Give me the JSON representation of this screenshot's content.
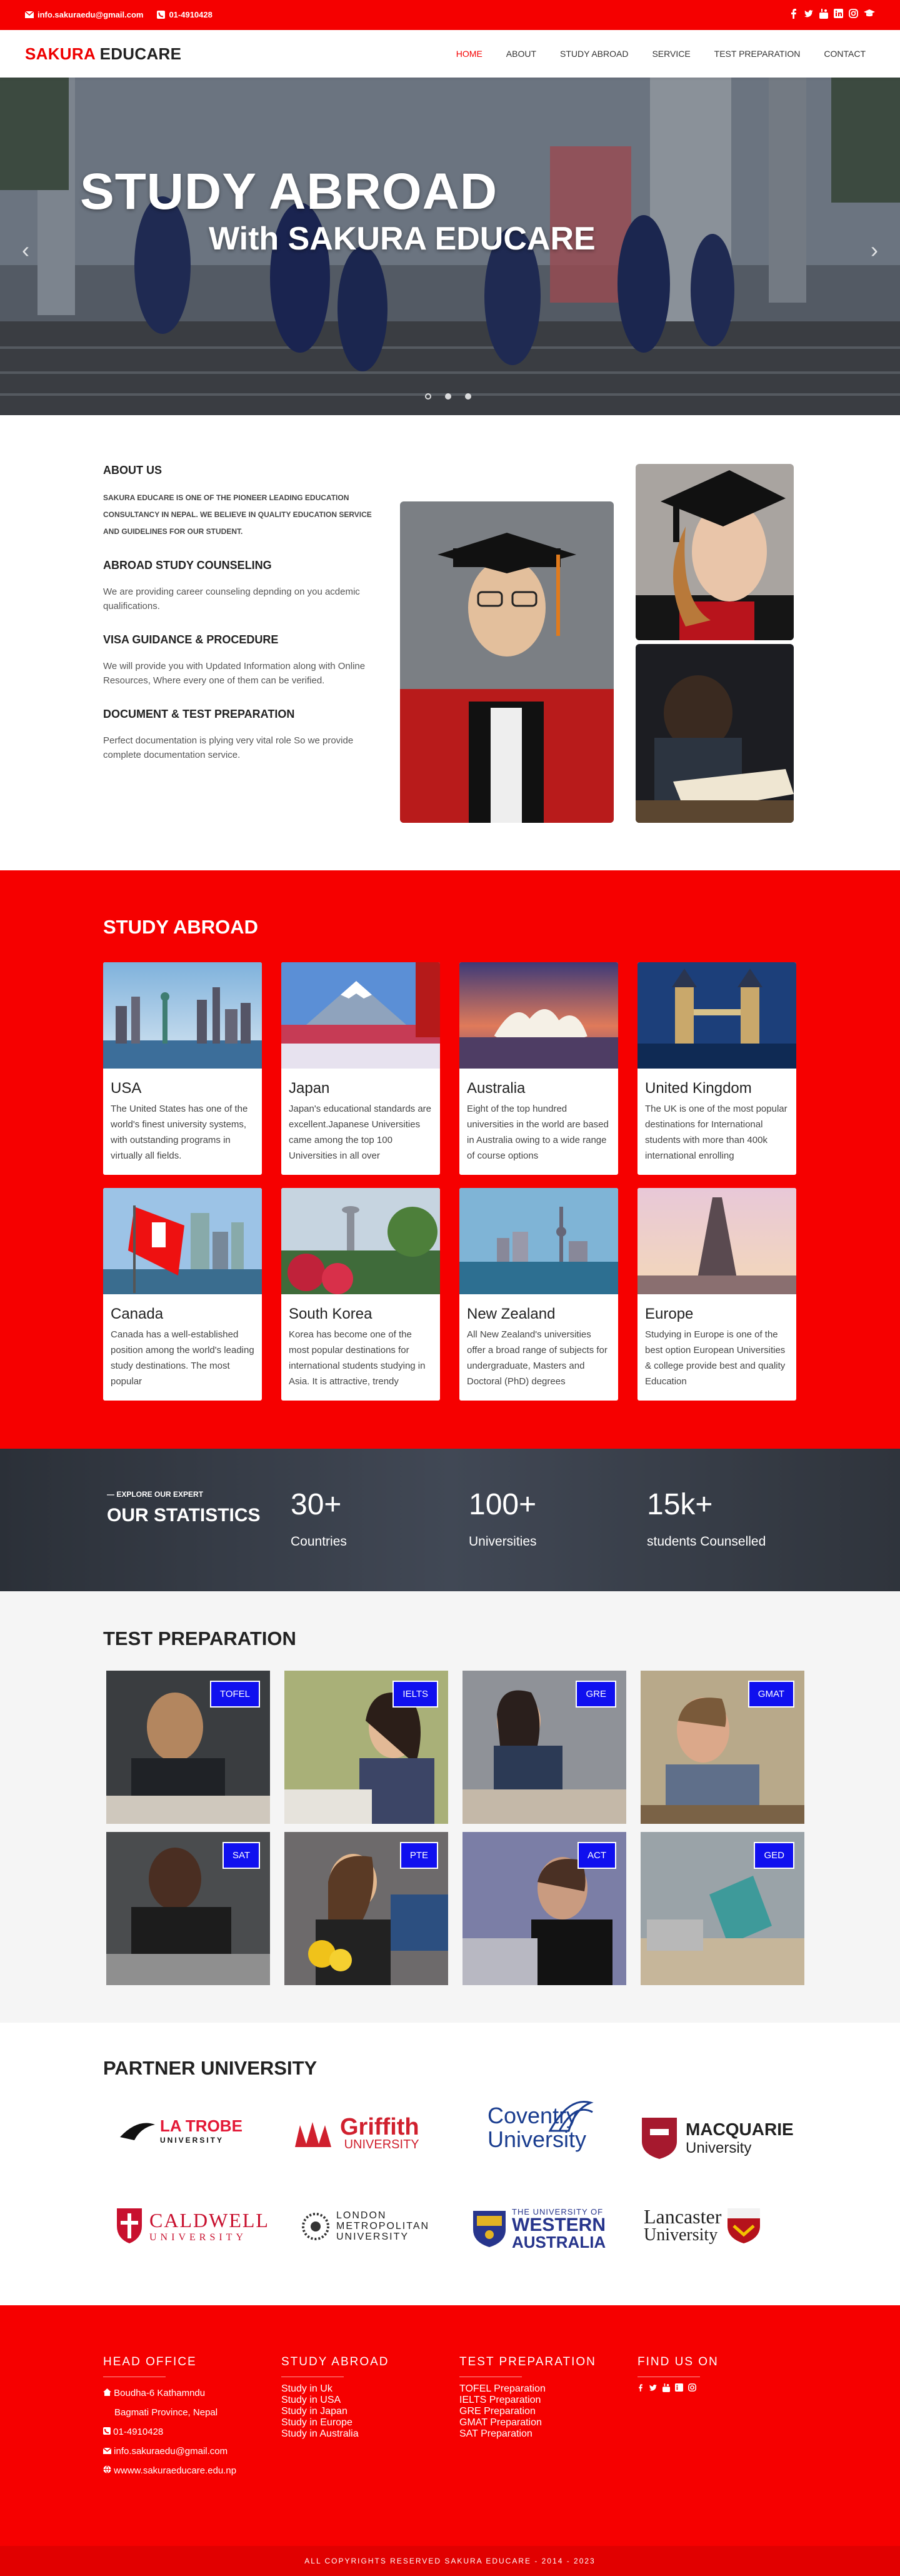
{
  "topbar": {
    "email": "info.sakuraedu@gmail.com",
    "phone": "01-4910428",
    "social_icons": [
      "facebook-icon",
      "twitter-icon",
      "youtube-icon",
      "linkedin-icon",
      "instagram-icon",
      "graduation-cap-icon"
    ]
  },
  "nav": {
    "logo_red": "SAKURA",
    "logo_dark": "EDUCARE",
    "items": [
      "HOME",
      "ABOUT",
      "STUDY ABROAD",
      "SERVICE",
      "TEST PREPARATION",
      "CONTACT"
    ]
  },
  "hero": {
    "title": "STUDY ABROAD",
    "subtitle": "With SAKURA EDUCARE",
    "prev": "‹",
    "next": "›"
  },
  "about": {
    "heading": "ABOUT US",
    "intro": "SAKURA EDUCARE IS ONE OF THE PIONEER LEADING EDUCATION CONSULTANCY IN NEPAL. WE BELIEVE IN QUALITY EDUCATION SERVICE AND GUIDELINES FOR OUR STUDENT.",
    "sections": [
      {
        "title": "ABROAD STUDY COUNSELING",
        "text": "We are providing career counseling depnding on you acdemic qualifications."
      },
      {
        "title": "VISA GUIDANCE & PROCEDURE",
        "text": "We will provide you with Updated Information along with Online Resources, Where every one of them can be verified."
      },
      {
        "title": "DOCUMENT & TEST PREPARATION",
        "text": "Perfect documentation is plying very vital role So we provide complete documentation service."
      }
    ]
  },
  "study": {
    "heading": "STUDY ABROAD",
    "cards": [
      {
        "name": "USA",
        "text": "The United States has one of the world's finest university systems, with outstanding programs in virtually all fields."
      },
      {
        "name": "Japan",
        "text": "Japan's educational standards are excellent.Japanese Universities came among the top 100 Universities in all over"
      },
      {
        "name": "Australia",
        "text": "Eight of the top hundred universities in the world are based in Australia owing to a wide range of course options"
      },
      {
        "name": "United Kingdom",
        "text": "The UK is one of the most popular destinations for International students with more than 400k international enrolling"
      },
      {
        "name": "Canada",
        "text": "Canada has a well-established position among the world's leading study destinations. The most popular"
      },
      {
        "name": "South Korea",
        "text": "Korea has become one of the most popular destinations for international students studying in Asia. It is attractive, trendy"
      },
      {
        "name": "New Zealand",
        "text": "All New Zealand's universities offer a broad range of subjects for undergraduate, Masters and Doctoral (PhD) degrees"
      },
      {
        "name": "Europe",
        "text": "Studying in Europe is one of the best option European Universities & college provide best and quality Education"
      }
    ]
  },
  "stats": {
    "kicker": "— EXPLORE OUR EXPERT",
    "title": "OUR STATISTICS",
    "items": [
      {
        "num": "30+",
        "label": "Countries"
      },
      {
        "num": "100+",
        "label": "Universities"
      },
      {
        "num": "15k+",
        "label": "students Counselled"
      }
    ]
  },
  "test": {
    "heading": "TEST PREPARATION",
    "tiles": [
      "TOFEL",
      "IELTS",
      "GRE",
      "GMAT",
      "SAT",
      "PTE",
      "ACT",
      "GED"
    ]
  },
  "partner": {
    "heading": "PARTNER UNIVERSITY",
    "logos": [
      {
        "a": "LA TROBE",
        "b": "UNIVERSITY"
      },
      {
        "a": "Griffith",
        "b": "UNIVERSITY"
      },
      {
        "a": "Coventry",
        "b": "University"
      },
      {
        "a": "MACQUARIE",
        "b": "University"
      },
      {
        "a": "CALDWELL",
        "b": "UNIVERSITY"
      },
      {
        "a": "LONDON",
        "b": "METROPOLITAN",
        "c": "UNIVERSITY"
      },
      {
        "a": "THE UNIVERSITY OF",
        "b": "WESTERN",
        "c": "AUSTRALIA"
      },
      {
        "a": "Lancaster",
        "b": "University"
      }
    ]
  },
  "footer": {
    "head_office": {
      "title": "HEAD OFFICE",
      "lines": [
        "Boudha-6 Kathamndu",
        "Bagmati Province, Nepal",
        "01-4910428",
        "info.sakuraedu@gmail.com",
        "wwww.sakuraeducare.edu.np"
      ]
    },
    "study_abroad": {
      "title": "STUDY ABROAD",
      "links": [
        "Study in Uk",
        "Study in USA",
        "Study in Japan",
        "Study in Europe",
        "Study in Australia"
      ]
    },
    "test_prep": {
      "title": "TEST PREPARATION",
      "links": [
        "TOFEL Preparation",
        "IELTS Preparation",
        "GRE Preparation",
        "GMAT Preparation",
        "SAT Preparation"
      ]
    },
    "find_us": {
      "title": "FIND US ON"
    },
    "copyright": "ALL COPYRIGHTS RESERVED SAKURA EDUCARE - 2014 - 2023"
  },
  "colors": {
    "brand_red": "#f60000",
    "badge_blue": "#1010ef"
  }
}
